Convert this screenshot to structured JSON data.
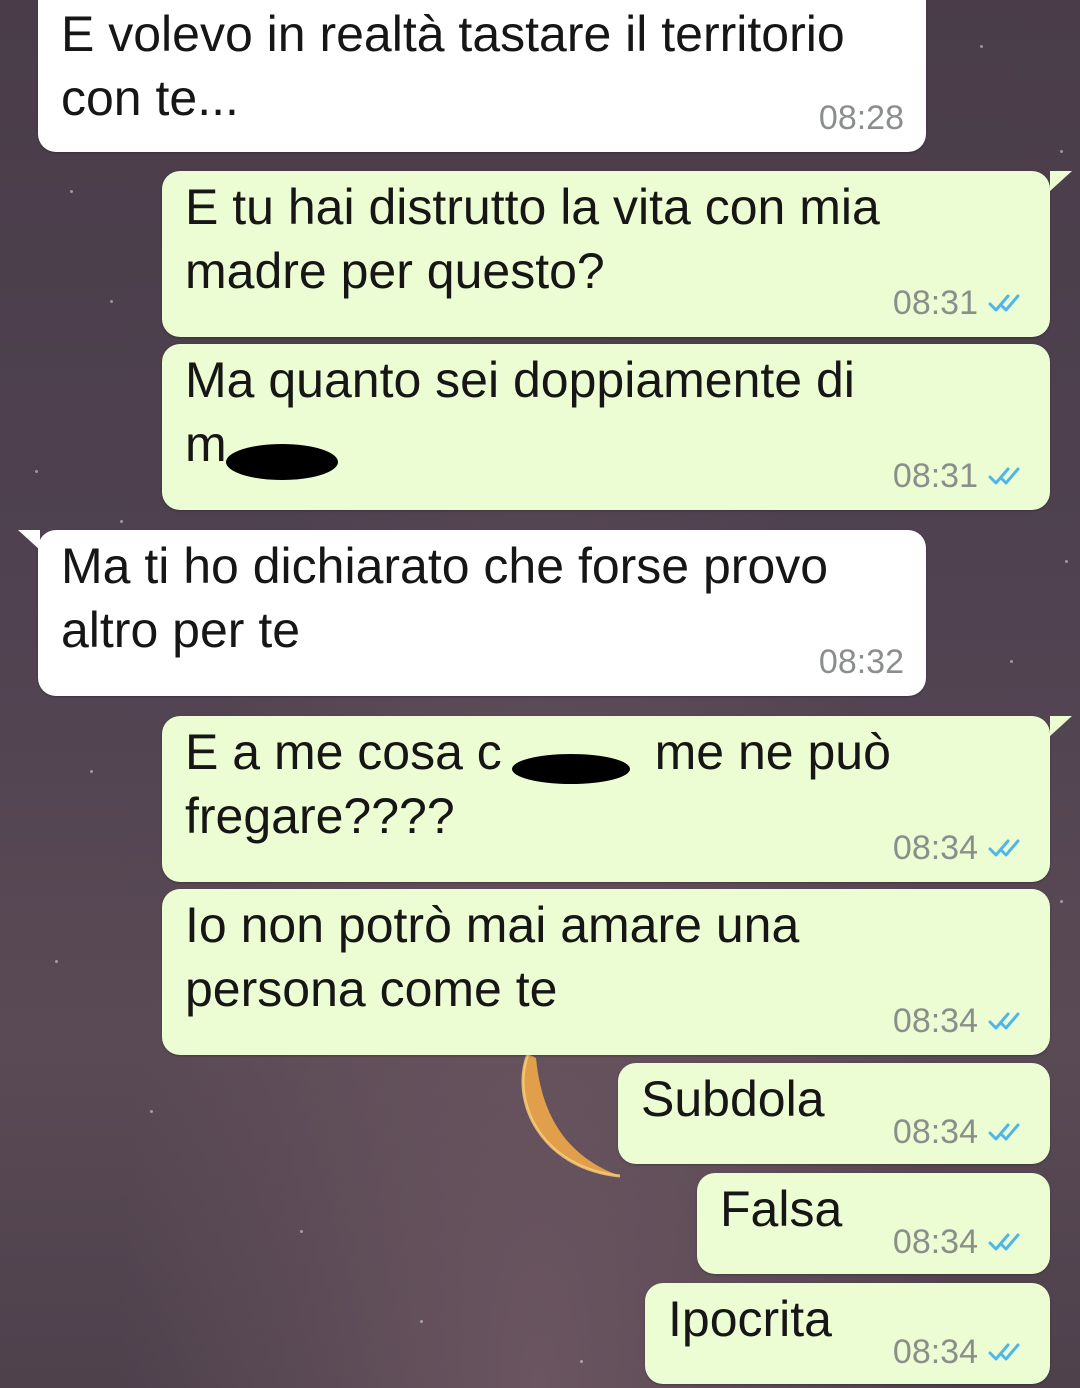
{
  "messages": [
    {
      "direction": "in",
      "text": "E volevo in realtà tastare il territorio\ncon te...",
      "time": "08:28"
    },
    {
      "direction": "out",
      "text": "E tu hai distrutto la vita con mia\nmadre per questo?",
      "time": "08:31",
      "status": "read"
    },
    {
      "direction": "out",
      "text": "Ma quanto sei doppiamente di\nm",
      "time": "08:31",
      "status": "read"
    },
    {
      "direction": "in",
      "text": "Ma ti ho dichiarato che forse provo\naltro per te",
      "time": "08:32"
    },
    {
      "direction": "out",
      "text": "E a me cosa c           me ne può\nfregare????",
      "time": "08:34",
      "status": "read"
    },
    {
      "direction": "out",
      "text": "Io non potrò mai amare una\npersona come te",
      "time": "08:34",
      "status": "read"
    },
    {
      "direction": "out",
      "text": "Subdola",
      "time": "08:34",
      "status": "read"
    },
    {
      "direction": "out",
      "text": "Falsa",
      "time": "08:34",
      "status": "read"
    },
    {
      "direction": "out",
      "text": "Ipocrita",
      "time": "08:34",
      "status": "read"
    }
  ],
  "icons": {
    "read_receipt": "double-check-icon",
    "read_color": "#4fb6ec"
  },
  "colors": {
    "incoming_bubble": "#ffffff",
    "outgoing_bubble": "#ecfdd3",
    "timestamp": "#8a8f8c"
  }
}
